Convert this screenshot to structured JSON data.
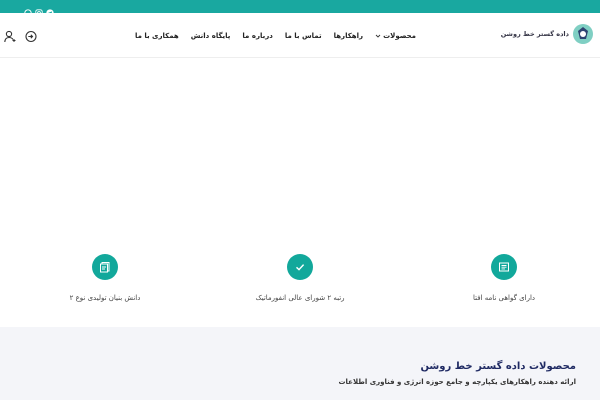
{
  "colors": {
    "topbar": "#19a8a0",
    "accent": "#12a89b",
    "heading": "#1f2a63",
    "products_bg": "#f4f5f9"
  },
  "topbar": {
    "social_icons": [
      "telegram-icon",
      "instagram-icon",
      "whatsapp-icon"
    ]
  },
  "header": {
    "logo_text": "داده گستر خط روشن",
    "nav": [
      {
        "label": "محصولات",
        "has_dropdown": true
      },
      {
        "label": "راهکارها"
      },
      {
        "label": "تماس با ما"
      },
      {
        "label": "درباره ما"
      },
      {
        "label": "پایگاه دانش"
      },
      {
        "label": "همکاری با ما"
      }
    ],
    "user_icons": [
      "login-icon",
      "user-account-icon"
    ]
  },
  "features": [
    {
      "label": "دارای گواهی نامه افتا",
      "icon": "certificate-icon"
    },
    {
      "label": "رتبه ۲ شورای عالی انفورماتیک",
      "icon": "check-icon"
    },
    {
      "label": "دانش بنیان تولیدی نوع ۲",
      "icon": "knowledge-icon"
    }
  ],
  "products": {
    "title": "محصولات داده گستر خط روشن",
    "subtitle": "ارائه دهنده راهکارهای یکپارچه و جامع حوزه انرژی و فناوری اطلاعات"
  }
}
